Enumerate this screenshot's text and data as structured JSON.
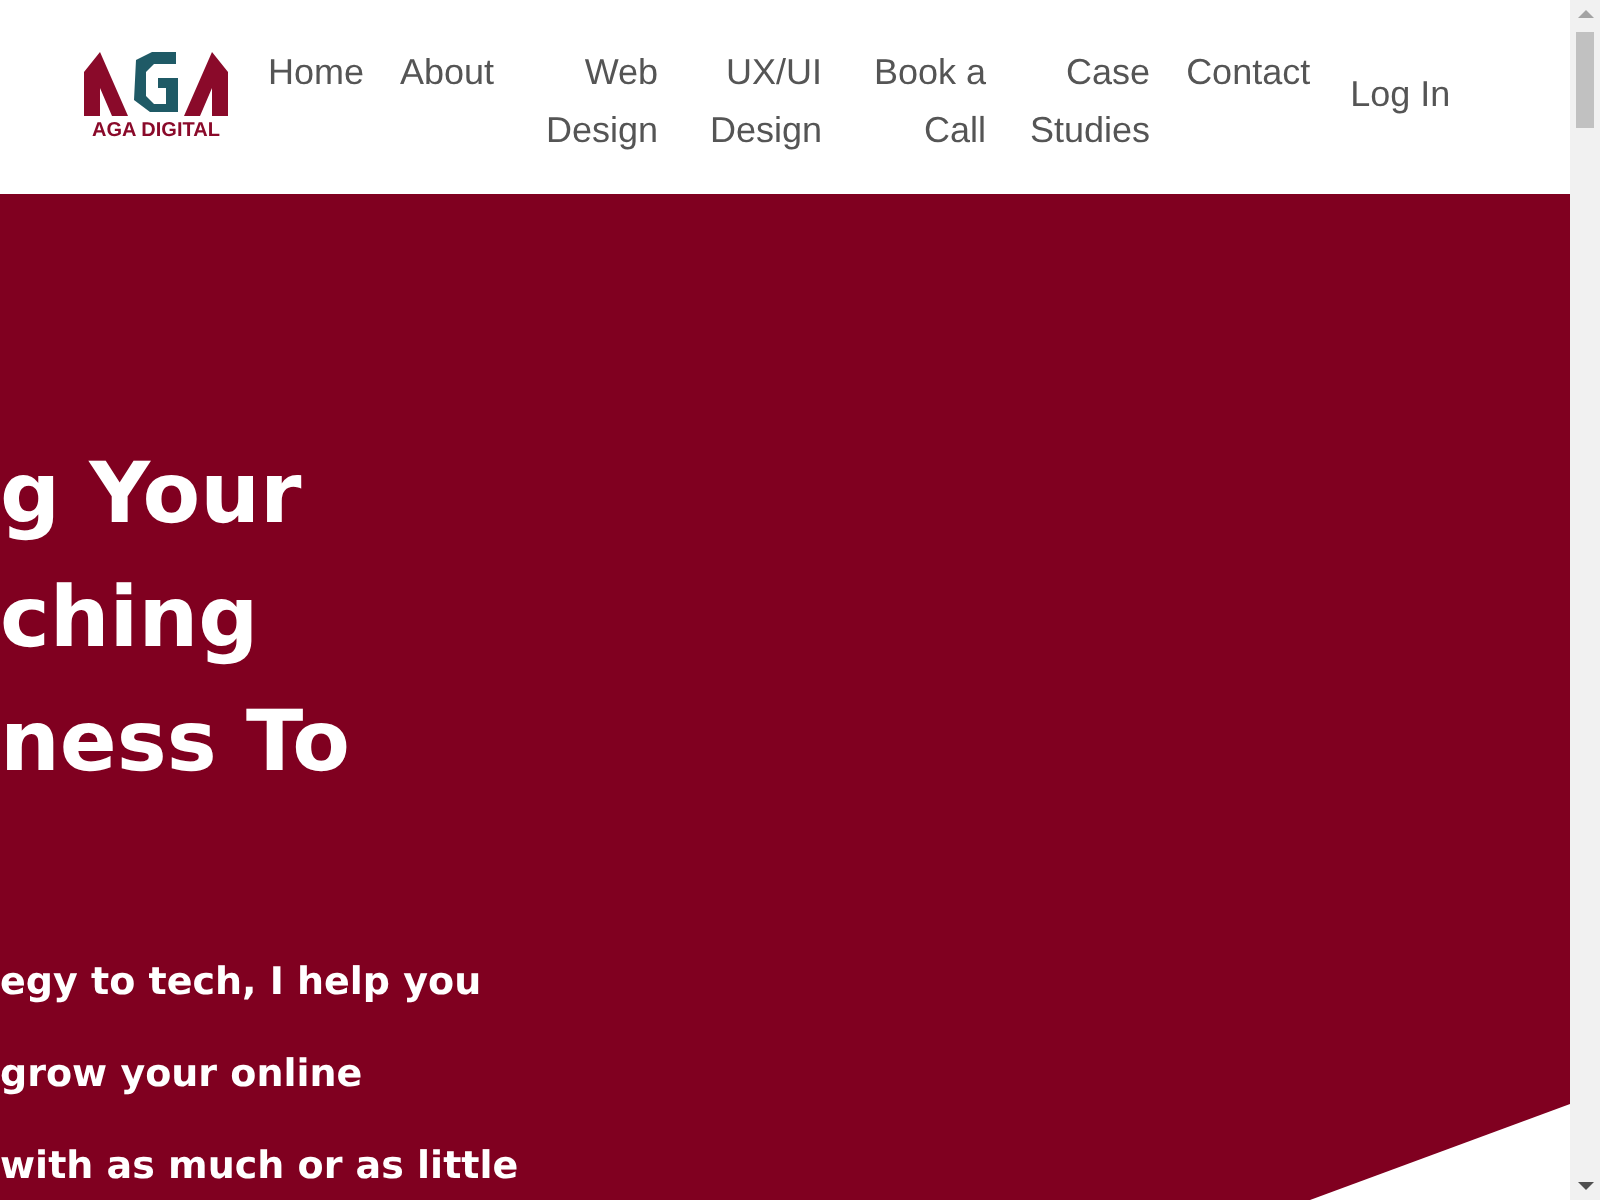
{
  "header": {
    "logo_text": "AGA DIGITAL",
    "nav": [
      {
        "label": "Home"
      },
      {
        "label": "About"
      },
      {
        "label": "Web Design"
      },
      {
        "label": "UX/UI Design"
      },
      {
        "label": "Book a Call"
      },
      {
        "label": "Case Studies"
      },
      {
        "label": "Contact"
      }
    ],
    "login": "Log In"
  },
  "hero": {
    "headline_lines": [
      "g Your",
      "ching",
      "ness To"
    ],
    "body_lines": [
      "egy to tech, I help you",
      "grow your online",
      "with as much or as little"
    ]
  }
}
